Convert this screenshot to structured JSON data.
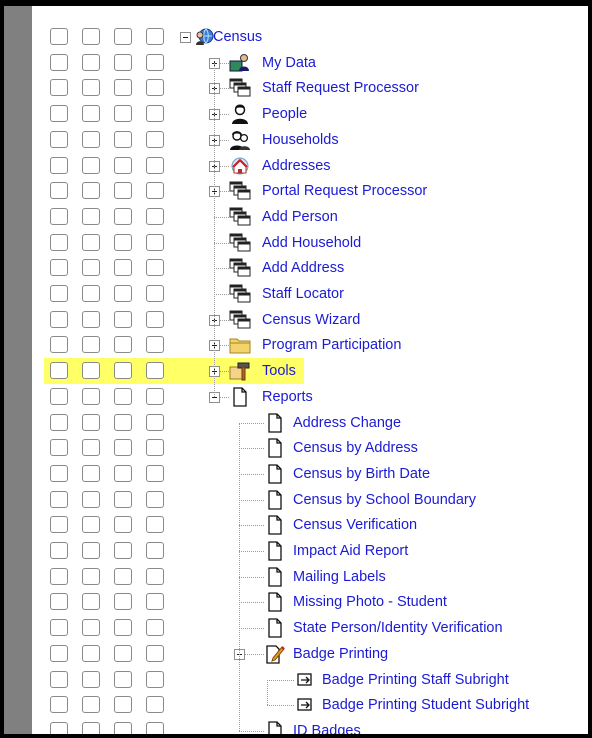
{
  "tree": {
    "root": {
      "label": "Census",
      "icon": "census-globe-icon",
      "expanded": true
    },
    "items": [
      {
        "label": "My Data",
        "icon": "my-data-icon",
        "level": 1,
        "toggle": "plus"
      },
      {
        "label": "Staff Request Processor",
        "icon": "window-stack-icon",
        "level": 1,
        "toggle": "plus"
      },
      {
        "label": "People",
        "icon": "person-icon",
        "level": 1,
        "toggle": "plus"
      },
      {
        "label": "Households",
        "icon": "household-people-icon",
        "level": 1,
        "toggle": "plus"
      },
      {
        "label": "Addresses",
        "icon": "address-house-icon",
        "level": 1,
        "toggle": "plus"
      },
      {
        "label": "Portal Request Processor",
        "icon": "window-stack-icon",
        "level": 1,
        "toggle": "plus"
      },
      {
        "label": "Add Person",
        "icon": "window-stack-icon",
        "level": 1,
        "toggle": ""
      },
      {
        "label": "Add Household",
        "icon": "window-stack-icon",
        "level": 1,
        "toggle": ""
      },
      {
        "label": "Add Address",
        "icon": "window-stack-icon",
        "level": 1,
        "toggle": ""
      },
      {
        "label": "Staff Locator",
        "icon": "window-stack-icon",
        "level": 1,
        "toggle": ""
      },
      {
        "label": "Census Wizard",
        "icon": "window-stack-icon",
        "level": 1,
        "toggle": "plus"
      },
      {
        "label": "Program Participation",
        "icon": "folder-icon",
        "level": 1,
        "toggle": "plus"
      },
      {
        "label": "Tools",
        "icon": "tools-hammer-icon",
        "level": 1,
        "toggle": "plus",
        "highlighted": true
      },
      {
        "label": "Reports",
        "icon": "document-icon",
        "level": 1,
        "toggle": "minus"
      },
      {
        "label": "Address Change",
        "icon": "document-icon",
        "level": 2,
        "toggle": ""
      },
      {
        "label": "Census by Address",
        "icon": "document-icon",
        "level": 2,
        "toggle": ""
      },
      {
        "label": "Census by Birth Date",
        "icon": "document-icon",
        "level": 2,
        "toggle": ""
      },
      {
        "label": "Census by School Boundary",
        "icon": "document-icon",
        "level": 2,
        "toggle": ""
      },
      {
        "label": "Census Verification",
        "icon": "document-icon",
        "level": 2,
        "toggle": ""
      },
      {
        "label": "Impact Aid Report",
        "icon": "document-icon",
        "level": 2,
        "toggle": ""
      },
      {
        "label": "Mailing Labels",
        "icon": "document-icon",
        "level": 2,
        "toggle": ""
      },
      {
        "label": "Missing Photo - Student",
        "icon": "document-icon",
        "level": 2,
        "toggle": ""
      },
      {
        "label": "State Person/Identity Verification",
        "icon": "document-icon",
        "level": 2,
        "toggle": ""
      },
      {
        "label": "Badge Printing",
        "icon": "document-edit-icon",
        "level": 2,
        "toggle": "minus"
      },
      {
        "label": "Badge Printing Staff Subright",
        "icon": "subright-arrow-icon",
        "level": 3,
        "toggle": ""
      },
      {
        "label": "Badge Printing Student Subright",
        "icon": "subright-arrow-icon",
        "level": 3,
        "toggle": ""
      },
      {
        "label": "ID Badges",
        "icon": "document-icon",
        "level": 2,
        "toggle": ""
      }
    ]
  },
  "colors": {
    "link": "#1b1bd6",
    "highlight": "#ffff66",
    "sidebar": "#808080"
  }
}
